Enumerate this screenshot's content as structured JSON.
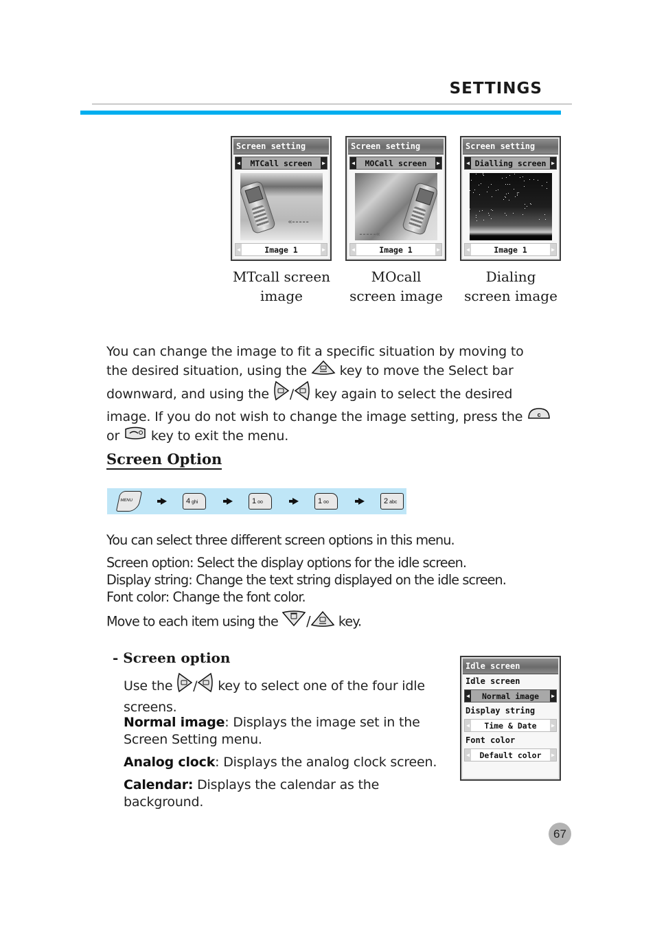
{
  "header": {
    "title": "SETTINGS",
    "accent_color": "#00aeef"
  },
  "screens": [
    {
      "title": "Screen setting",
      "selector": "MTCall screen",
      "value": "Image 1",
      "caption_line1": "MTcall screen",
      "caption_line2": "image"
    },
    {
      "title": "Screen setting",
      "selector": "MOCall screen",
      "value": "Image 1",
      "caption_line1": "MOcall",
      "caption_line2": "screen image"
    },
    {
      "title": "Screen setting",
      "selector": "Dialling screen",
      "value": "Image 1",
      "caption_line1": "Dialing",
      "caption_line2": "screen image"
    }
  ],
  "intro": {
    "line1": "You can change the image to fit a specific situation by moving to",
    "line2a": "the desired situation, using the",
    "line2b": "key to move the Select bar",
    "line3a": "downward, and using the",
    "line3b": "/",
    "line3c": "key again to select the desired",
    "line4a": "image. If you do not wish to change the image setting, press the",
    "line5a": "or",
    "line5b": "key to exit the menu."
  },
  "screen_option": {
    "heading": "Screen Option",
    "key_sequence": [
      {
        "label": "MENU",
        "sub": ""
      },
      {
        "label": "4",
        "sub": "ghi"
      },
      {
        "label": "1",
        "sub": "oo"
      },
      {
        "label": "1",
        "sub": "oo"
      },
      {
        "label": "2",
        "sub": "abc"
      }
    ],
    "para1": "You can select three different screen options in this menu.",
    "para2_line1": "Screen option: Select the display options for the idle screen.",
    "para2_line2": "Display string: Change the text string displayed on the idle screen.",
    "para2_line3": "Font color: Change the font color.",
    "para3a": "Move to each item using the",
    "para3b": "/",
    "para3c": "key."
  },
  "sub_section": {
    "heading": "- Screen option",
    "use_a": "Use the",
    "use_b": "/",
    "use_c": "key to select one of the four idle",
    "use_d": "screens.",
    "items": [
      {
        "term": "Normal image",
        "sep": ":",
        "desc1": " Displays the image set in the",
        "desc2": "Screen Setting menu."
      },
      {
        "term": "Analog clock",
        "sep": ":",
        "desc1": " Displays the analog clock screen.",
        "desc2": ""
      },
      {
        "term": "Calendar:",
        "sep": "",
        "desc1": " Displays the calendar as the",
        "desc2": "background."
      }
    ]
  },
  "idle_screen": {
    "title": "Idle screen",
    "label1": "Idle screen",
    "value1": "Normal image",
    "label2": "Display string",
    "value2": "Time & Date",
    "label3": "Font color",
    "value3": "Default color"
  },
  "page_number": "67"
}
